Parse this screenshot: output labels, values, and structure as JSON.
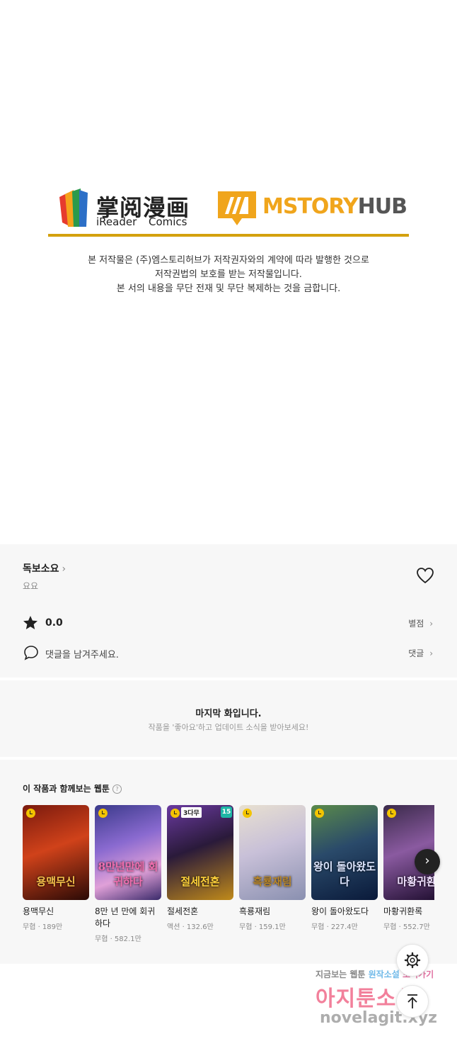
{
  "logos": {
    "ireader_cn": "掌阅漫画",
    "ireader_en_1": "iReader",
    "ireader_en_2": "Comics",
    "mstory_main": "MSTORY",
    "mstory_hub": "HUB"
  },
  "notice_lines": [
    "본 저작물은 (주)엠스토리허브가 저작권자와의 계약에 따라 발행한 것으로",
    "저작권법의 보호를 받는 저작물입니다.",
    "본 서의 내용을 무단 전재 및 무단 복제하는 것을 금합니다."
  ],
  "work": {
    "title": "독보소요",
    "author": "요요",
    "rating": "0.0",
    "rate_label": "별점",
    "comment_prompt": "댓글을 남겨주세요.",
    "comment_label": "댓글"
  },
  "end": {
    "title": "마지막 화입니다.",
    "subtitle": "작품을 '좋아요'하고 업데이트 소식을 받아보세요!"
  },
  "recommend": {
    "title": "이 작품과 함께보는 웹툰",
    "help_glyph": "?",
    "next_glyph": "›",
    "items": [
      {
        "title": "용맥무신",
        "meta": "무협 · 189만",
        "art": "용맥무신",
        "badge": "",
        "num": ""
      },
      {
        "title": "8만 년 만에 회귀하다",
        "meta": "무협 · 582.1만",
        "art": "8만년만에 회귀하다",
        "badge": "",
        "num": ""
      },
      {
        "title": "절세전혼",
        "meta": "액션 · 132.6만",
        "art": "절세전혼",
        "badge": "3다무",
        "num": "15"
      },
      {
        "title": "흑룡재림",
        "meta": "무협 · 159.1만",
        "art": "흑룡재림",
        "badge": "",
        "num": ""
      },
      {
        "title": "왕이 돌아왔도다",
        "meta": "무협 · 227.4만",
        "art": "왕이 돌아왔도다",
        "badge": "",
        "num": ""
      },
      {
        "title": "마황귀환록",
        "meta": "무협 · 552.7만",
        "art": "마황귀환",
        "badge": "",
        "num": ""
      }
    ]
  },
  "watermark": {
    "line1_a": "지금보는 웹툰",
    "line1_b": "원작소설",
    "line1_c": "보러가기",
    "line2": "아지툰소설",
    "line3": "novelagit.xyz"
  },
  "colors": {
    "accent_gold": "#d4a10e",
    "mstory_orange": "#f0a51c",
    "panel_bg": "#f7f7f7"
  },
  "icons": [
    "ireader-logo-icon",
    "mstory-logo-icon",
    "heart-icon",
    "star-icon",
    "comment-icon",
    "help-icon",
    "clock-icon",
    "chevron-right-icon",
    "settings-icon",
    "arrow-up-icon"
  ]
}
